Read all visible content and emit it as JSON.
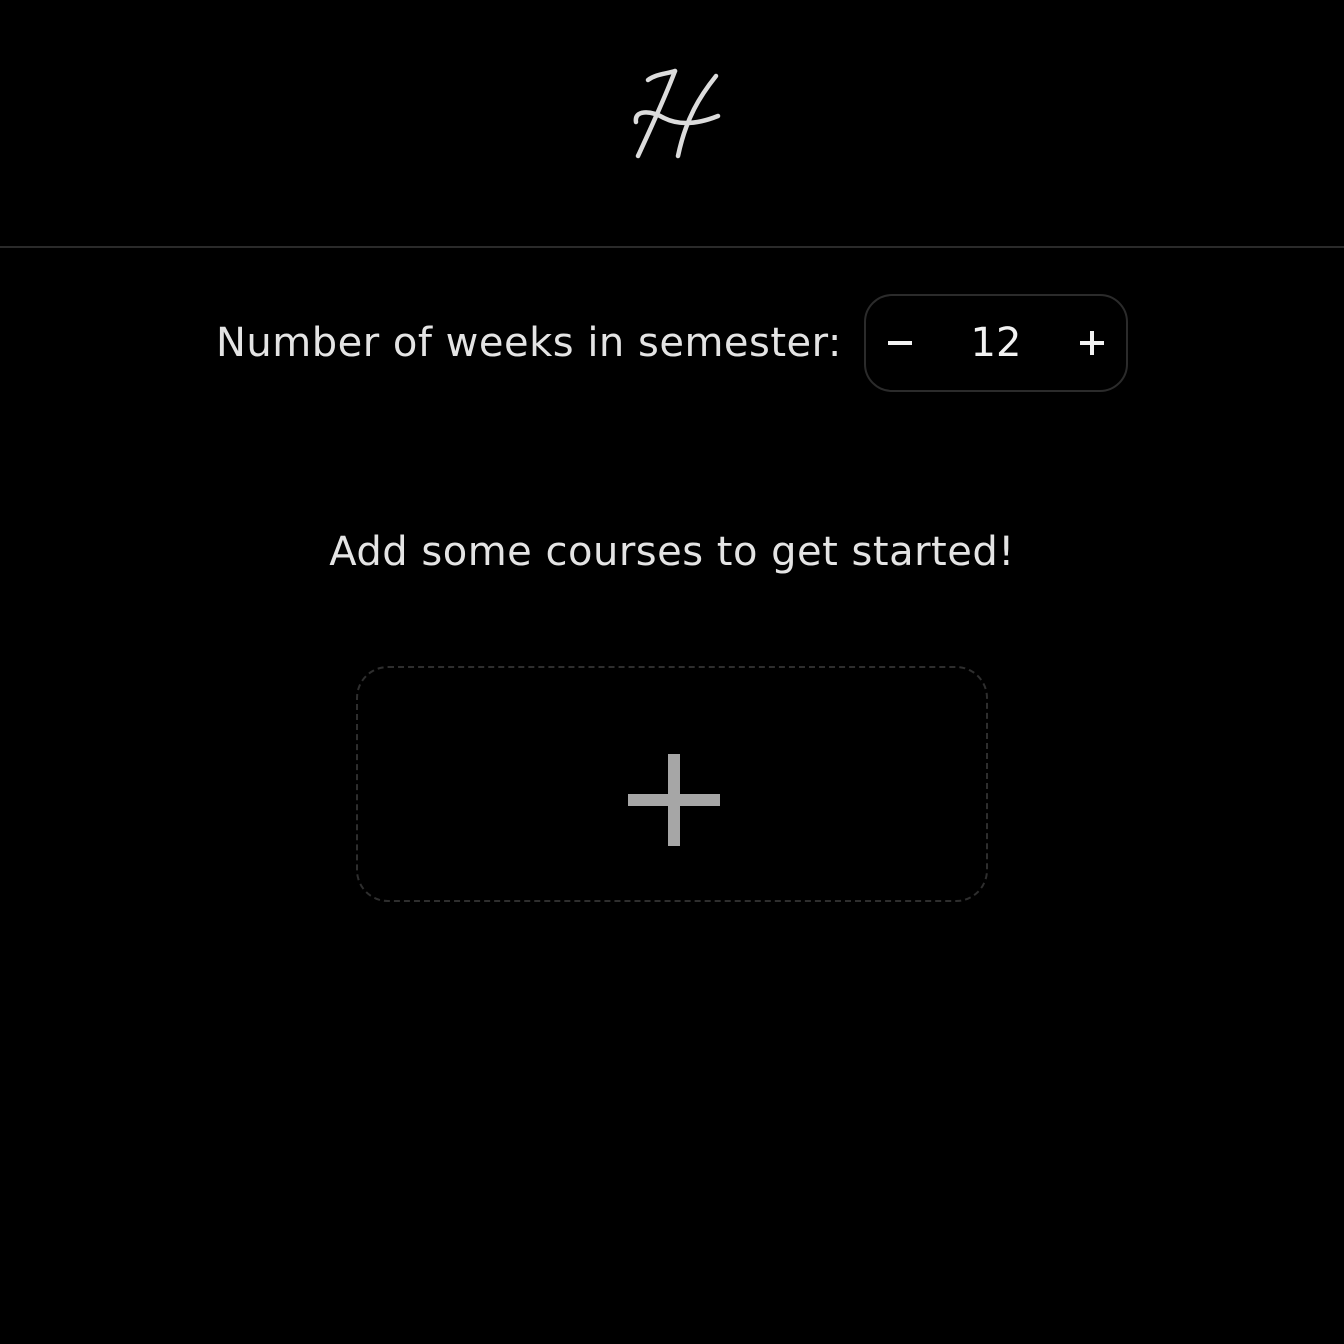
{
  "header": {
    "logo": {
      "icon": "script-h-logo-icon",
      "color": "#dcdcdc"
    }
  },
  "semester": {
    "weeks_label": "Number of weeks in semester:",
    "weeks_value": "12",
    "decrement_icon": "minus-icon",
    "increment_icon": "plus-icon"
  },
  "courses": {
    "empty_message": "Add some courses to get started!",
    "add_icon": "plus-icon"
  },
  "colors": {
    "background": "#000000",
    "text": "#e4e4e4",
    "border": "#2b2b2b",
    "add_icon": "#a6a6a6"
  }
}
